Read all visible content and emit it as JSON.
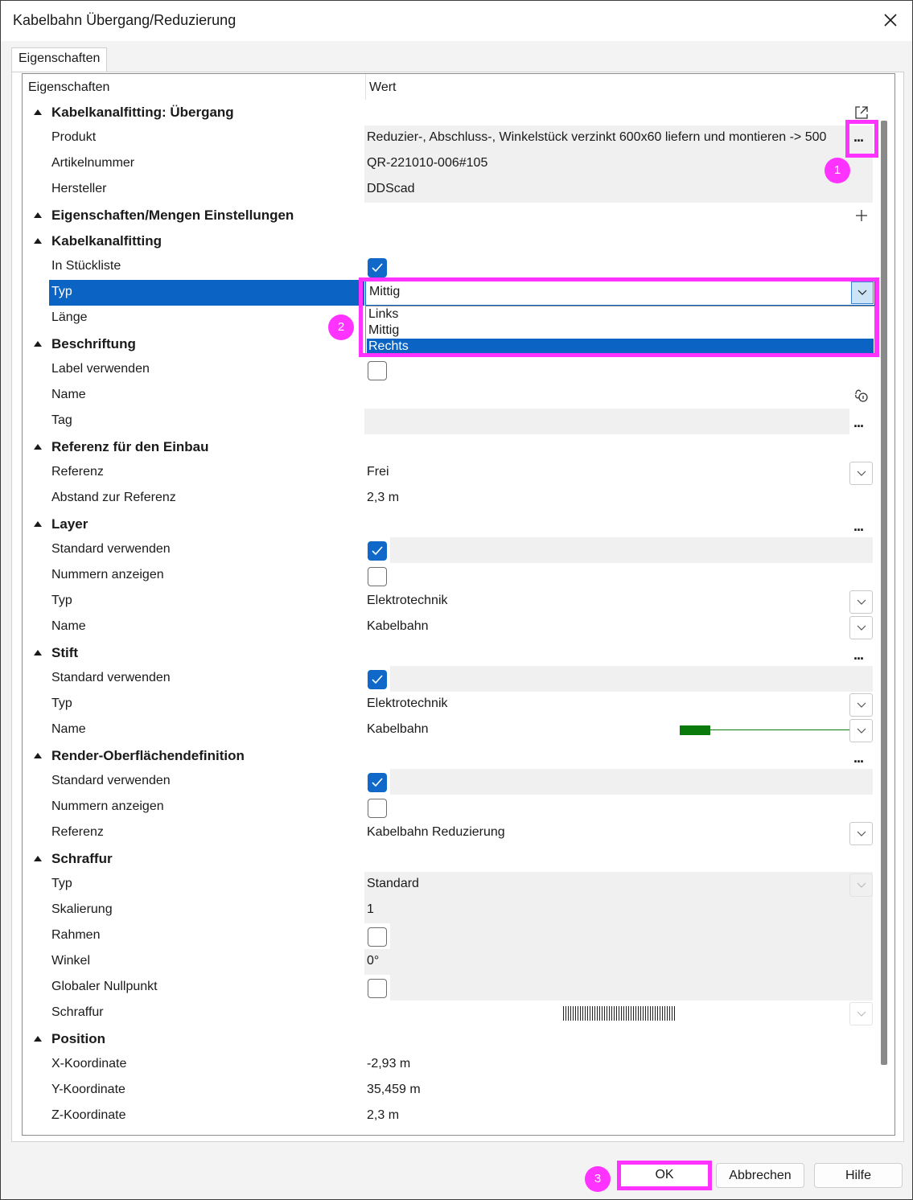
{
  "window": {
    "title": "Kabelbahn Übergang/Reduzierung"
  },
  "tabs": [
    {
      "label": "Eigenschaften"
    }
  ],
  "grid": {
    "header_property": "Eigenschaften",
    "header_value": "Wert",
    "rows": [
      {
        "kind": "cat",
        "label": "Kabelkanalfitting: Übergang"
      },
      {
        "kind": "prop",
        "label": "Produkt",
        "value": "Reduzier-, Abschluss-, Winkelstück verzinkt 600x60 liefern und montieren -> 500"
      },
      {
        "kind": "prop",
        "label": "Artikelnummer",
        "value": "QR-221010-006#105"
      },
      {
        "kind": "prop",
        "label": "Hersteller",
        "value": "DDScad"
      },
      {
        "kind": "cat",
        "label": "Eigenschaften/Mengen Einstellungen"
      },
      {
        "kind": "cat",
        "label": "Kabelkanalfitting"
      },
      {
        "kind": "prop",
        "label": "In Stückliste",
        "checked": true
      },
      {
        "kind": "prop",
        "label": "Typ",
        "value": "Mittig"
      },
      {
        "kind": "prop",
        "label": "Länge"
      },
      {
        "kind": "cat",
        "label": "Beschriftung"
      },
      {
        "kind": "prop",
        "label": "Label verwenden",
        "checked": false
      },
      {
        "kind": "prop",
        "label": "Name"
      },
      {
        "kind": "prop",
        "label": "Tag"
      },
      {
        "kind": "cat",
        "label": "Referenz für den Einbau"
      },
      {
        "kind": "prop",
        "label": "Referenz",
        "value": "Frei"
      },
      {
        "kind": "prop",
        "label": "Abstand zur Referenz",
        "value": "2,3 m"
      },
      {
        "kind": "cat",
        "label": "Layer"
      },
      {
        "kind": "prop",
        "label": "Standard verwenden",
        "checked": true
      },
      {
        "kind": "prop",
        "label": "Nummern anzeigen",
        "checked": false
      },
      {
        "kind": "prop",
        "label": "Typ",
        "value": "Elektrotechnik"
      },
      {
        "kind": "prop",
        "label": "Name",
        "value": "Kabelbahn"
      },
      {
        "kind": "cat",
        "label": "Stift"
      },
      {
        "kind": "prop",
        "label": "Standard verwenden",
        "checked": true
      },
      {
        "kind": "prop",
        "label": "Typ",
        "value": "Elektrotechnik"
      },
      {
        "kind": "prop",
        "label": "Name",
        "value": "Kabelbahn"
      },
      {
        "kind": "cat",
        "label": "Render-Oberflächendefinition"
      },
      {
        "kind": "prop",
        "label": "Standard verwenden",
        "checked": true
      },
      {
        "kind": "prop",
        "label": "Nummern anzeigen",
        "checked": false
      },
      {
        "kind": "prop",
        "label": "Referenz",
        "value": "Kabelbahn Reduzierung"
      },
      {
        "kind": "cat",
        "label": "Schraffur"
      },
      {
        "kind": "prop",
        "label": "Typ",
        "value": "Standard"
      },
      {
        "kind": "prop",
        "label": "Skalierung",
        "value": "1"
      },
      {
        "kind": "prop",
        "label": "Rahmen",
        "checked": false
      },
      {
        "kind": "prop",
        "label": "Winkel",
        "value": "0°"
      },
      {
        "kind": "prop",
        "label": "Globaler Nullpunkt",
        "checked": false
      },
      {
        "kind": "prop",
        "label": "Schraffur"
      },
      {
        "kind": "cat",
        "label": "Position"
      },
      {
        "kind": "prop",
        "label": "X-Koordinate",
        "value": "-2,93 m"
      },
      {
        "kind": "prop",
        "label": "Y-Koordinate",
        "value": "35,459 m"
      },
      {
        "kind": "prop",
        "label": "Z-Koordinate",
        "value": "2,3 m"
      }
    ]
  },
  "typ_dropdown": {
    "selected": "Mittig",
    "options": [
      "Links",
      "Mittig",
      "Rechts"
    ],
    "highlighted": "Rechts"
  },
  "ellipsis": "...",
  "annotations": [
    "1",
    "2",
    "3"
  ],
  "colors": {
    "accent": "#0b64c4",
    "highlight": "#ff33ff",
    "pen": "#0a7a0a"
  },
  "icons": [
    "close-icon",
    "expand-icon",
    "ellipsis-icon",
    "plus-icon",
    "link-icon",
    "chevron-down-icon",
    "checkmark-icon"
  ],
  "buttons": {
    "ok": "OK",
    "cancel": "Abbrechen",
    "help": "Hilfe"
  }
}
